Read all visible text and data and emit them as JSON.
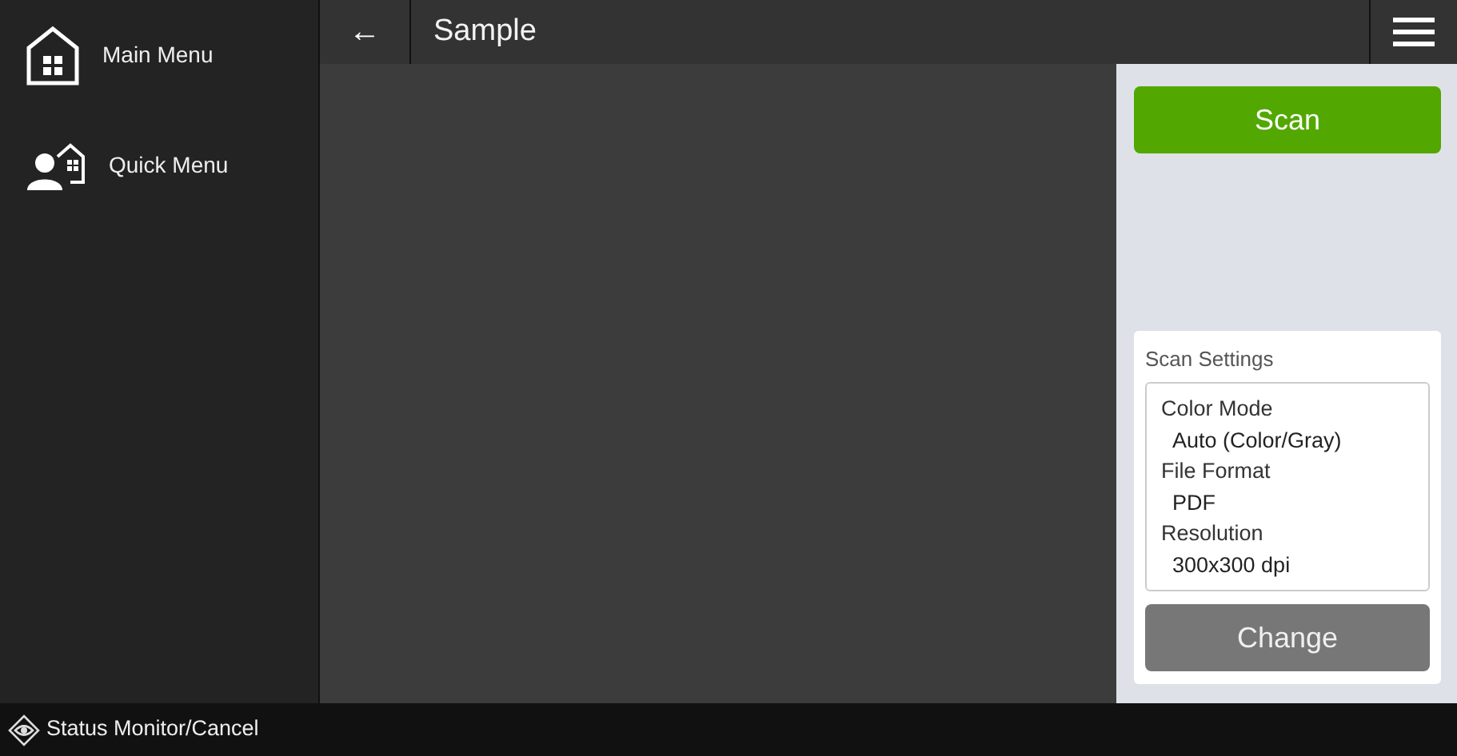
{
  "sidebar": {
    "items": [
      {
        "kind": "home",
        "label": "Main Menu"
      },
      {
        "kind": "quick",
        "label": "Quick Menu"
      }
    ]
  },
  "header": {
    "back": "←",
    "title": "Sample"
  },
  "scan_button": "Scan",
  "scan_settings": {
    "title": "Scan Settings",
    "items": [
      {
        "label": "Color Mode",
        "value": "Auto (Color/Gray)"
      },
      {
        "label": "File Format",
        "value": "PDF"
      },
      {
        "label": "Resolution",
        "value": "300x300 dpi"
      }
    ],
    "button": "Change"
  },
  "status_bar": {
    "label": "Status Monitor/Cancel"
  }
}
